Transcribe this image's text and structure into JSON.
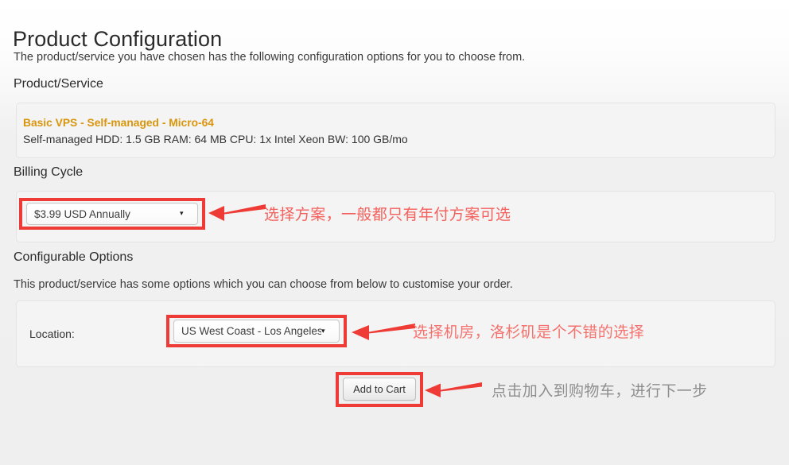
{
  "page": {
    "title": "Product Configuration",
    "intro": "The product/service you have chosen has the following configuration options for you to choose from."
  },
  "product_service": {
    "section_label": "Product/Service",
    "name": "Basic VPS - Self-managed - Micro-64",
    "specs": "Self-managed HDD: 1.5 GB RAM: 64 MB CPU: 1x Intel Xeon BW: 100 GB/mo",
    "name_color": "#d9950c"
  },
  "billing_cycle": {
    "section_label": "Billing Cycle",
    "selected": "$3.99 USD Annually",
    "dropdown_arrow": "▾"
  },
  "configurable_options": {
    "section_label": "Configurable Options",
    "description": "This product/service has some options which you can choose from below to customise your order.",
    "location_label": "Location:",
    "location_selected": "US West Coast - Los Angeles (l",
    "dropdown_arrow": "▾"
  },
  "actions": {
    "add_to_cart": "Add to Cart"
  },
  "annotations": {
    "billing": {
      "text": "选择方案，一般都只有年付方案可选",
      "color": "#f4605c"
    },
    "location": {
      "text": "选择机房，洛杉矶是个不错的选择",
      "color": "#f4726e"
    },
    "cart": {
      "text": "点击加入到购物车，进行下一步",
      "color": "#8e8e8e"
    },
    "highlight_color": "#ef3b36",
    "arrow_color": "#ef3b36"
  }
}
